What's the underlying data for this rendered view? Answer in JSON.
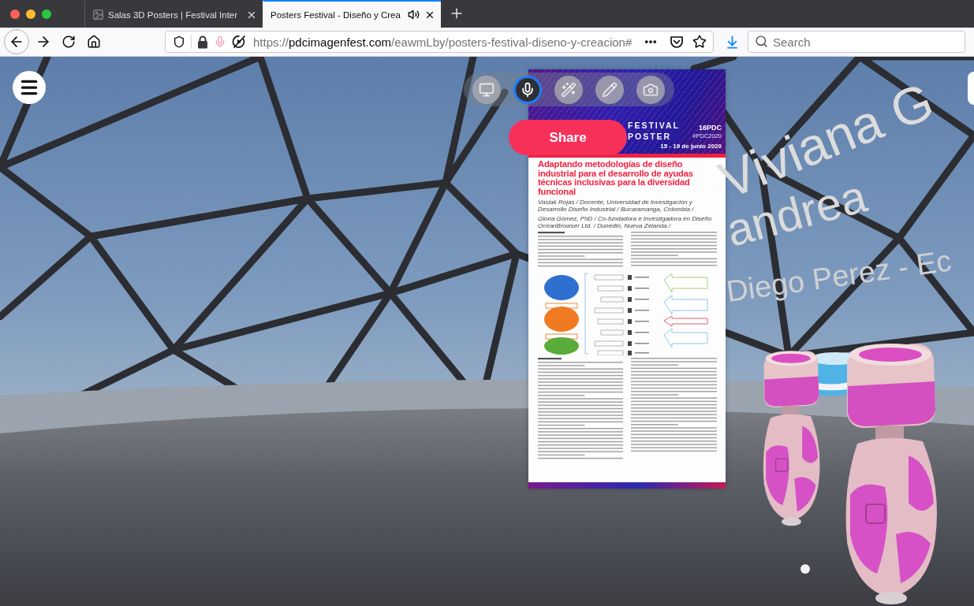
{
  "browser": {
    "tabs": [
      {
        "title": "Salas 3D Posters | Festival Inter",
        "selected": false,
        "audio": false
      },
      {
        "title": "Posters Festival - Diseño y Crea",
        "selected": true,
        "audio": true
      }
    ],
    "address": {
      "scheme": "https://",
      "domain": "pdcimagenfest.com",
      "path": "/eawmLby/posters-festival-diseno-y-creacion#"
    },
    "search": {
      "placeholder": "Search"
    }
  },
  "scene": {
    "toolbar": [
      {
        "kind": "screen",
        "selected": false
      },
      {
        "kind": "microphone",
        "selected": true
      },
      {
        "kind": "wand",
        "selected": false
      },
      {
        "kind": "pen",
        "selected": false
      },
      {
        "kind": "camera",
        "selected": false
      }
    ],
    "share_button": "Share",
    "poster": {
      "header": {
        "title_lines": [
          "FESTIVAL",
          "POSTER"
        ],
        "edition": "16PDC",
        "hashtag": "#PDC2020",
        "dates": "15 - 19 de junio 2020"
      },
      "title": "Adaptando metodologías de diseño industrial para el desarrollo de ayudas técnicas inclusivas para la diversidad funcional",
      "authors": [
        "Vaslak Rojas / Docente, Universidad de Investigación y Desarrollo Diseño Industrial / Bucaramanga, Colombia /",
        "Gloria Gómez, PhD / Co-fundadora e Investigadora en Diseño OceanBrowser Ltd. / Dunedin, Nueva Zelanda /"
      ]
    },
    "name_tags": [
      "Viviana G",
      "andrea",
      "Diego Perez - Ec"
    ]
  }
}
